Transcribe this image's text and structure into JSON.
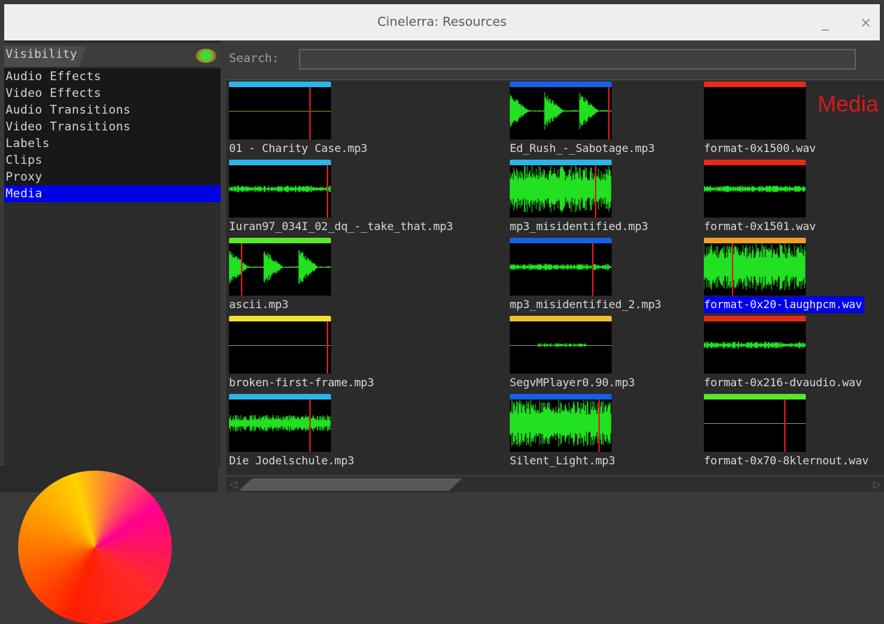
{
  "window": {
    "title": "Cinelerra: Resources",
    "minimize_glyph": "_",
    "close_glyph": "×"
  },
  "sidebar": {
    "visibility_label": "Visibility",
    "items": [
      {
        "label": "Audio Effects",
        "selected": false
      },
      {
        "label": "Video Effects",
        "selected": false
      },
      {
        "label": "Audio Transitions",
        "selected": false
      },
      {
        "label": "Video Transitions",
        "selected": false
      },
      {
        "label": "Labels",
        "selected": false
      },
      {
        "label": "Clips",
        "selected": false
      },
      {
        "label": "Proxy",
        "selected": false
      },
      {
        "label": "Media",
        "selected": true
      }
    ]
  },
  "search": {
    "label": "Search:",
    "value": ""
  },
  "main": {
    "folder_title": "Media",
    "assets": [
      {
        "name": "01 - Charity Case.mp3",
        "stripe": "#2ab4ea",
        "cursor": 0.8,
        "wave": "flat",
        "selected": false
      },
      {
        "name": "Ed_Rush_-_Sabotage.mp3",
        "stripe": "#1460e8",
        "cursor": 0.98,
        "wave": "bursts",
        "selected": false
      },
      {
        "name": "format-0x1500.wav",
        "stripe": "#e82a14",
        "cursor": null,
        "wave": "none",
        "selected": false
      },
      {
        "name": "Iuran97_034I_02_dq_-_take_that.mp3",
        "stripe": "#2ab4ea",
        "cursor": 0.97,
        "wave": "thin",
        "selected": false
      },
      {
        "name": "mp3_misidentified.mp3",
        "stripe": "#2ab4ea",
        "cursor": 0.85,
        "wave": "dense",
        "selected": false
      },
      {
        "name": "format-0x1501.wav",
        "stripe": "#e82a14",
        "cursor": null,
        "wave": "thin",
        "selected": false
      },
      {
        "name": "ascii.mp3",
        "stripe": "#5ae82a",
        "cursor": 0.12,
        "wave": "bursts",
        "selected": false
      },
      {
        "name": "mp3_misidentified_2.mp3",
        "stripe": "#1460e8",
        "cursor": 0.82,
        "wave": "thin",
        "selected": false
      },
      {
        "name": "format-0x20-laughpcm.wav",
        "stripe": "#f0a028",
        "cursor": 0.28,
        "wave": "dense",
        "selected": true
      },
      {
        "name": "broken-first-frame.mp3",
        "stripe": "#f0e02a",
        "cursor": 0.97,
        "wave": "flat",
        "selected": false
      },
      {
        "name": "SegvMPlayer0.90.mp3",
        "stripe": "#f0c028",
        "cursor": null,
        "wave": "faint",
        "selected": false
      },
      {
        "name": "format-0x216-dvaudio.wav",
        "stripe": "#e82a14",
        "cursor": null,
        "wave": "thin",
        "selected": false
      },
      {
        "name": "Die Jodelschule.mp3",
        "stripe": "#2ab4ea",
        "cursor": 0.8,
        "wave": "medium",
        "selected": false
      },
      {
        "name": "Silent_Light.mp3",
        "stripe": "#1460e8",
        "cursor": 0.88,
        "wave": "dense",
        "selected": false
      },
      {
        "name": "format-0x70-8klernout.wav",
        "stripe": "#5ae82a",
        "cursor": 0.8,
        "wave": "crosshair",
        "selected": false
      }
    ]
  }
}
